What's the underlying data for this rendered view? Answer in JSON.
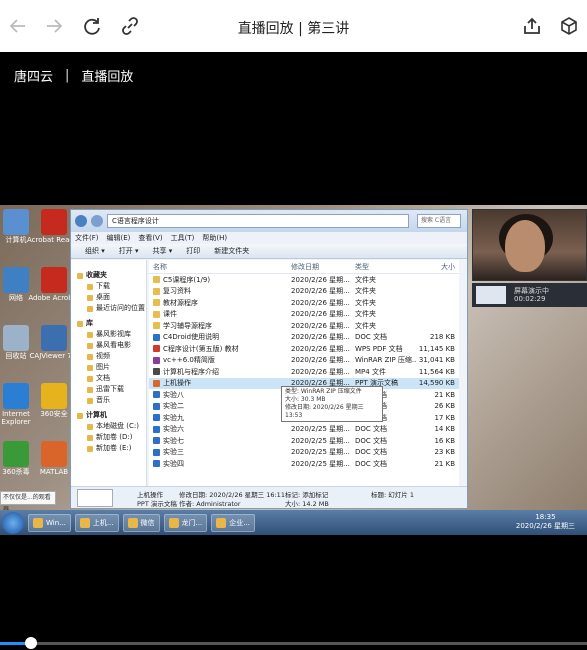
{
  "header": {
    "title": "直播回放 | 第三讲",
    "icons": [
      "back-icon",
      "forward-icon",
      "reload-icon",
      "link-icon",
      "share-icon",
      "cube-icon"
    ]
  },
  "video_meta": {
    "teacher": "唐四云",
    "separator": "|",
    "label": "直播回放"
  },
  "desktop_icons": [
    {
      "label": "计算机",
      "color": "#5a8fd0"
    },
    {
      "label": "Acrobat Reader",
      "color": "#c62a1f"
    },
    {
      "label": "网络",
      "color": "#3f7fc4"
    },
    {
      "label": "Adobe Acrobat",
      "color": "#c62a1f"
    },
    {
      "label": "回收站",
      "color": "#9bb2c8"
    },
    {
      "label": "CAJViewer 7.2",
      "color": "#3d6fb0"
    },
    {
      "label": "Internet Explorer",
      "color": "#2a7fd4"
    },
    {
      "label": "360安全",
      "color": "#e6b31e"
    },
    {
      "label": "360杀毒",
      "color": "#3a9a3a"
    },
    {
      "label": "MATLAB",
      "color": "#d9652b"
    }
  ],
  "explorer": {
    "address": "C语言程序设计",
    "search_placeholder": "搜索 C语言",
    "menu": [
      "文件(F)",
      "编辑(E)",
      "查看(V)",
      "工具(T)",
      "帮助(H)"
    ],
    "commands": [
      "组织 ▾",
      "打开 ▾",
      "共享 ▾",
      "打印",
      "新建文件夹"
    ],
    "nav": [
      {
        "label": "收藏夹",
        "hdr": true
      },
      {
        "label": "下载",
        "hdr": false
      },
      {
        "label": "桌面",
        "hdr": false
      },
      {
        "label": "最近访问的位置",
        "hdr": false
      },
      {
        "label": "库",
        "hdr": true
      },
      {
        "label": "暴风影视库",
        "hdr": false
      },
      {
        "label": "暴风看电影",
        "hdr": false
      },
      {
        "label": "视频",
        "hdr": false
      },
      {
        "label": "图片",
        "hdr": false
      },
      {
        "label": "文档",
        "hdr": false
      },
      {
        "label": "迅雷下载",
        "hdr": false
      },
      {
        "label": "音乐",
        "hdr": false
      },
      {
        "label": "计算机",
        "hdr": true
      },
      {
        "label": "本地磁盘 (C:)",
        "hdr": false
      },
      {
        "label": "新加卷 (D:)",
        "hdr": false
      },
      {
        "label": "新加卷 (E:)",
        "hdr": false
      }
    ],
    "columns": {
      "name": "名称",
      "date": "修改日期",
      "type": "类型",
      "size": "大小"
    },
    "files": [
      {
        "name": "C5课程序(1/9)",
        "date": "2020/2/26 星期...",
        "type": "文件夹",
        "size": "",
        "icon": "folder"
      },
      {
        "name": "复习资料",
        "date": "2020/2/26 星期...",
        "type": "文件夹",
        "size": "",
        "icon": "folder"
      },
      {
        "name": "教材源程序",
        "date": "2020/2/26 星期...",
        "type": "文件夹",
        "size": "",
        "icon": "folder"
      },
      {
        "name": "课件",
        "date": "2020/2/26 星期...",
        "type": "文件夹",
        "size": "",
        "icon": "folder"
      },
      {
        "name": "学习辅导源程序",
        "date": "2020/2/26 星期...",
        "type": "文件夹",
        "size": "",
        "icon": "folder"
      },
      {
        "name": "C4Droid使用说明",
        "date": "2020/2/26 星期...",
        "type": "DOC 文档",
        "size": "218 KB",
        "icon": "doc"
      },
      {
        "name": "C程序设计(第五版) 教材",
        "date": "2020/2/26 星期...",
        "type": "WPS PDF 文档",
        "size": "11,145 KB",
        "icon": "pdf"
      },
      {
        "name": "vc++6.0精简版",
        "date": "2020/2/26 星期...",
        "type": "WinRAR ZIP 压缩...",
        "size": "31,041 KB",
        "icon": "rar"
      },
      {
        "name": "计算机与程序介绍",
        "date": "2020/2/26 星期...",
        "type": "MP4 文件",
        "size": "11,564 KB",
        "icon": "mp4"
      },
      {
        "name": "上机操作",
        "date": "2020/2/26 星期...",
        "type": "PPT 演示文稿",
        "size": "14,590 KB",
        "icon": "ppt",
        "selected": true
      },
      {
        "name": "实验八",
        "date": "2020/2/25 星期...",
        "type": "DOC 文档",
        "size": "21 KB",
        "icon": "doc"
      },
      {
        "name": "实验二",
        "date": "2020/2/25 星期...",
        "type": "DOC 文档",
        "size": "26 KB",
        "icon": "doc"
      },
      {
        "name": "实验九",
        "date": "2020/2/25 星期...",
        "type": "DOC 文档",
        "size": "17 KB",
        "icon": "doc"
      },
      {
        "name": "实验六",
        "date": "2020/2/25 星期...",
        "type": "DOC 文档",
        "size": "14 KB",
        "icon": "doc"
      },
      {
        "name": "实验七",
        "date": "2020/2/25 星期...",
        "type": "DOC 文档",
        "size": "16 KB",
        "icon": "doc"
      },
      {
        "name": "实验三",
        "date": "2020/2/25 星期...",
        "type": "DOC 文档",
        "size": "23 KB",
        "icon": "doc"
      },
      {
        "name": "实验四",
        "date": "2020/2/25 星期...",
        "type": "DOC 文档",
        "size": "21 KB",
        "icon": "doc"
      }
    ],
    "tooltip": {
      "line1": "类型: WinRAR ZIP 压缩文件",
      "line2": "大小: 30.3 MB",
      "line3": "修改日期: 2020/2/26 星期三 13:53"
    },
    "details": {
      "name": "上机操作",
      "kind": "PPT 演示文稿",
      "modified": "修改日期: 2020/2/26 星期三 16:11",
      "author": "作者: Administrator",
      "tags": "标记: 添加标记",
      "size": "大小: 14.2 MB",
      "title": "标题: 幻灯片 1"
    }
  },
  "camera": {
    "share_label": "屏幕演示中",
    "share_time": "00:02:29"
  },
  "taskbar": {
    "apps": [
      "Win...",
      "上机...",
      "微信",
      "龙门...",
      "企业..."
    ],
    "time": "18:35",
    "date": "2020/2/26 星期三"
  },
  "notification": "不仅仅是...的观看器",
  "playback": {
    "progress": 0.053
  }
}
